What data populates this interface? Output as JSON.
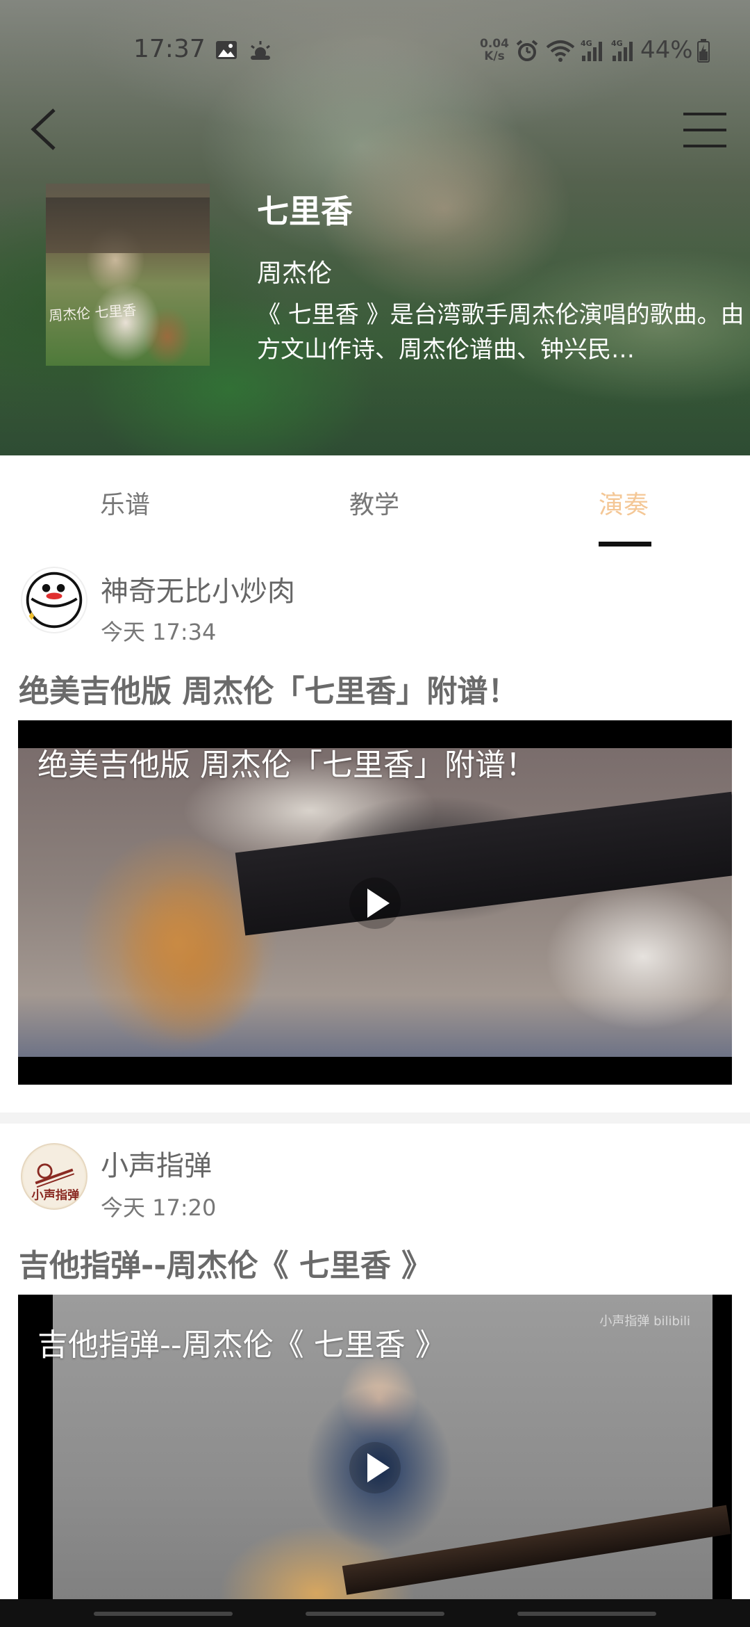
{
  "status_bar": {
    "time": "17:37",
    "net_speed_value": "0.04",
    "net_speed_unit": "K/s",
    "battery": "44%",
    "icons": [
      "image-icon",
      "weather-icon",
      "alarm-icon",
      "wifi-icon",
      "signal-4g-icon",
      "signal-4g-icon",
      "battery-charging-icon"
    ]
  },
  "header": {
    "back_icon": "chevron-left-icon",
    "menu_icon": "hamburger-menu-icon",
    "cover_text": "周杰伦 七里香",
    "song": {
      "title": "七里香",
      "artist": "周杰伦",
      "description": "《 七里香 》是台湾歌手周杰伦演唱的歌曲。由方文山作诗、周杰伦谱曲、钟兴民…"
    }
  },
  "tabs": {
    "items": [
      {
        "label": "乐谱",
        "active": false
      },
      {
        "label": "教学",
        "active": false
      },
      {
        "label": "演奏",
        "active": true
      }
    ],
    "active_color": "#f4c796"
  },
  "posts": [
    {
      "author": "神奇无比小炒肉",
      "time": "今天 17:34",
      "title": "绝美吉他版 周杰伦「七里香」附谱！",
      "video_caption": "绝美吉他版 周杰伦「七里香」附谱！"
    },
    {
      "author": "小声指弹",
      "time": "今天 17:20",
      "title": "吉他指弹--周杰伦《 七里香 》",
      "video_caption": "吉他指弹--周杰伦《 七里香 》",
      "watermark": "小声指弹 bilibili"
    }
  ]
}
